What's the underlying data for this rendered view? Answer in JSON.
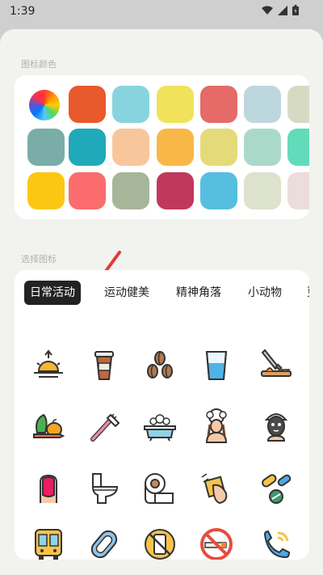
{
  "status_bar": {
    "time": "1:39"
  },
  "color_section": {
    "label": "图标颜色",
    "colors": [
      [
        "wheel",
        "#e8592b",
        "#88d4de",
        "#f0e35b",
        "#e46b68",
        "#bdd7de",
        "#d7dac3"
      ],
      [
        "#7aada7",
        "#20a9b9",
        "#f7c79b",
        "#f9b748",
        "#e5da7a",
        "#aad9ca",
        "#62dbbb"
      ],
      [
        "#fcc713",
        "#fb6c6e",
        "#a7b598",
        "#c0385b",
        "#56bedf",
        "#dde2cd",
        "#ebdddb"
      ]
    ]
  },
  "icon_section": {
    "label": "选择图标",
    "tabs": [
      {
        "label": "日常活动",
        "active": true
      },
      {
        "label": "运动健美",
        "active": false
      },
      {
        "label": "精神角落",
        "active": false
      },
      {
        "label": "小动物",
        "active": false
      },
      {
        "label": "更",
        "active": false
      }
    ],
    "icons": [
      [
        "sunrise-icon",
        "coffee-cup-icon",
        "coffee-beans-icon",
        "water-glass-icon",
        "cutting-board-icon"
      ],
      [
        "vegetables-icon",
        "toothbrush-icon",
        "bathtub-icon",
        "hair-wash-icon",
        "face-mask-icon"
      ],
      [
        "nail-polish-icon",
        "toilet-icon",
        "toilet-paper-icon",
        "cleaning-icon",
        "pills-icon"
      ],
      [
        "bus-icon",
        "sanitary-pad-icon",
        "no-phone-icon",
        "no-smoking-icon",
        "phone-call-icon"
      ]
    ]
  }
}
